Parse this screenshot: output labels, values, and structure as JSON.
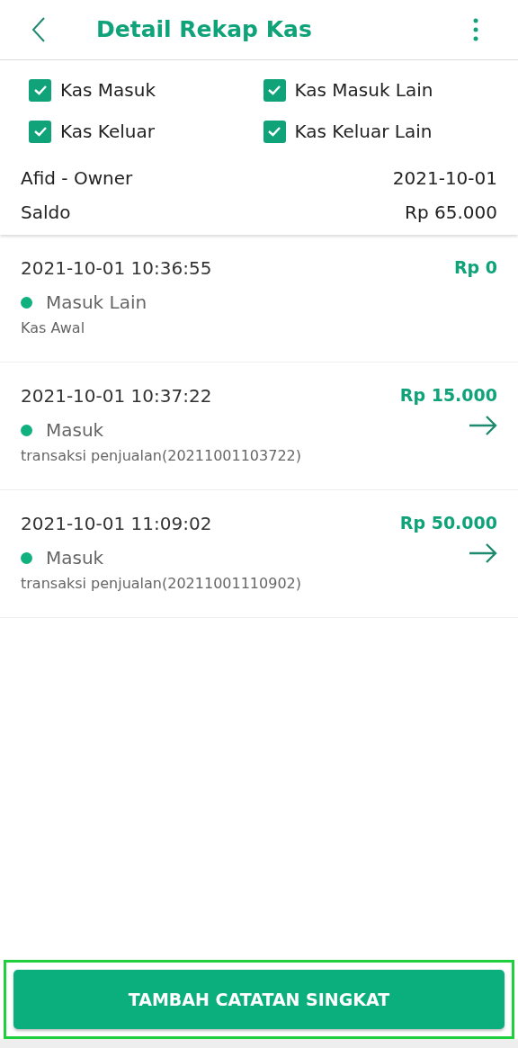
{
  "header": {
    "title": "Detail Rekap Kas"
  },
  "filters": [
    {
      "label": "Kas Masuk",
      "checked": true
    },
    {
      "label": "Kas Masuk Lain",
      "checked": true
    },
    {
      "label": "Kas Keluar",
      "checked": true
    },
    {
      "label": "Kas Keluar Lain",
      "checked": true
    }
  ],
  "summary": {
    "user": "Afid - Owner",
    "date": "2021-10-01",
    "balance_label": "Saldo",
    "balance": "Rp 65.000"
  },
  "entries": [
    {
      "time": "2021-10-01 10:36:55",
      "amount": "Rp 0",
      "type": "Masuk Lain",
      "color": "#10b07f",
      "note": "Kas Awal",
      "has_detail": false
    },
    {
      "time": "2021-10-01 10:37:22",
      "amount": "Rp 15.000",
      "type": "Masuk",
      "color": "#10b07f",
      "note": "transaksi penjualan(20211001103722)",
      "has_detail": true
    },
    {
      "time": "2021-10-01 11:09:02",
      "amount": "Rp 50.000",
      "type": "Masuk",
      "color": "#10b07f",
      "note": "transaksi penjualan(20211001110902)",
      "has_detail": true
    }
  ],
  "footer": {
    "button": "TAMBAH CATATAN SINGKAT",
    "highlighted": true
  }
}
